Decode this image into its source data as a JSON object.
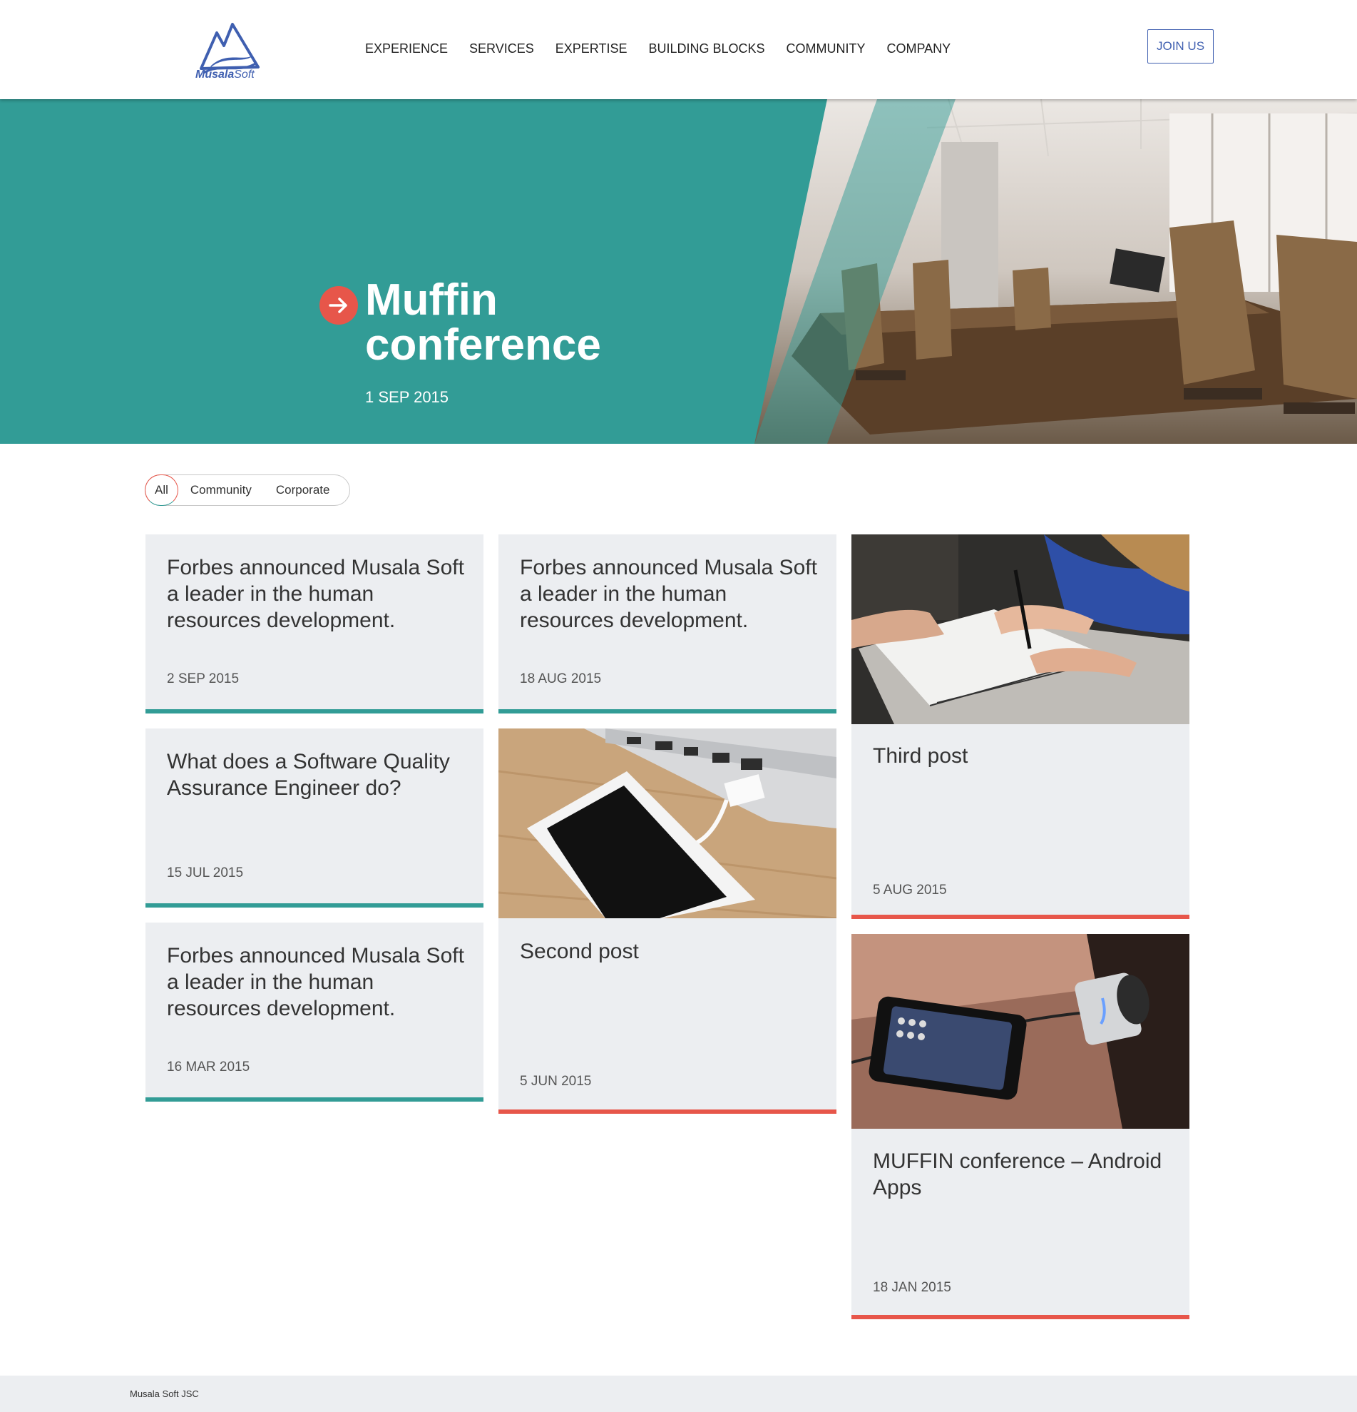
{
  "brand": {
    "name_part1": "Musala",
    "name_part2": "Soft",
    "logo_icon": "mountain-logo-icon",
    "accent_teal": "#329c96",
    "accent_red": "#e7564a",
    "accent_blue": "#3f5fb0"
  },
  "nav": {
    "items": [
      {
        "label": "EXPERIENCE"
      },
      {
        "label": "SERVICES"
      },
      {
        "label": "EXPERTISE"
      },
      {
        "label": "BUILDING BLOCKS"
      },
      {
        "label": "COMMUNITY"
      },
      {
        "label": "COMPANY"
      }
    ],
    "join_label": "JOIN US"
  },
  "hero": {
    "title": "Muffin conference",
    "date": "1 SEP 2015",
    "arrow_icon": "arrow-right-icon"
  },
  "filter": {
    "items": [
      {
        "label": "All",
        "active": true
      },
      {
        "label": "Community",
        "active": false
      },
      {
        "label": "Corporate",
        "active": false
      }
    ]
  },
  "posts": [
    {
      "title": "Forbes announced Musala Soft a leader in the human resources development.",
      "date": "2 SEP 2015",
      "category": "teal"
    },
    {
      "title": "Forbes announced Musala Soft a leader in the human resources development.",
      "date": "18 AUG 2015",
      "category": "teal"
    },
    {
      "title": "Third post",
      "date": "5 AUG 2015",
      "category": "red",
      "image": "writing-notebook-photo"
    },
    {
      "title": "What does a Software Quality Assurance Engineer do?",
      "date": "15 JUL 2015",
      "category": "teal"
    },
    {
      "title": "Second post",
      "date": "5 JUN 2015",
      "category": "red",
      "image": "phone-charging-photo"
    },
    {
      "title": "Forbes announced Musala Soft a leader in the human resources development.",
      "date": "16 MAR 2015",
      "category": "teal"
    },
    {
      "title": "MUFFIN conference – Android Apps",
      "date": "18 JAN 2015",
      "category": "red",
      "image": "phone-speaker-photo"
    }
  ],
  "footer": {
    "text": "Musala Soft JSC"
  }
}
